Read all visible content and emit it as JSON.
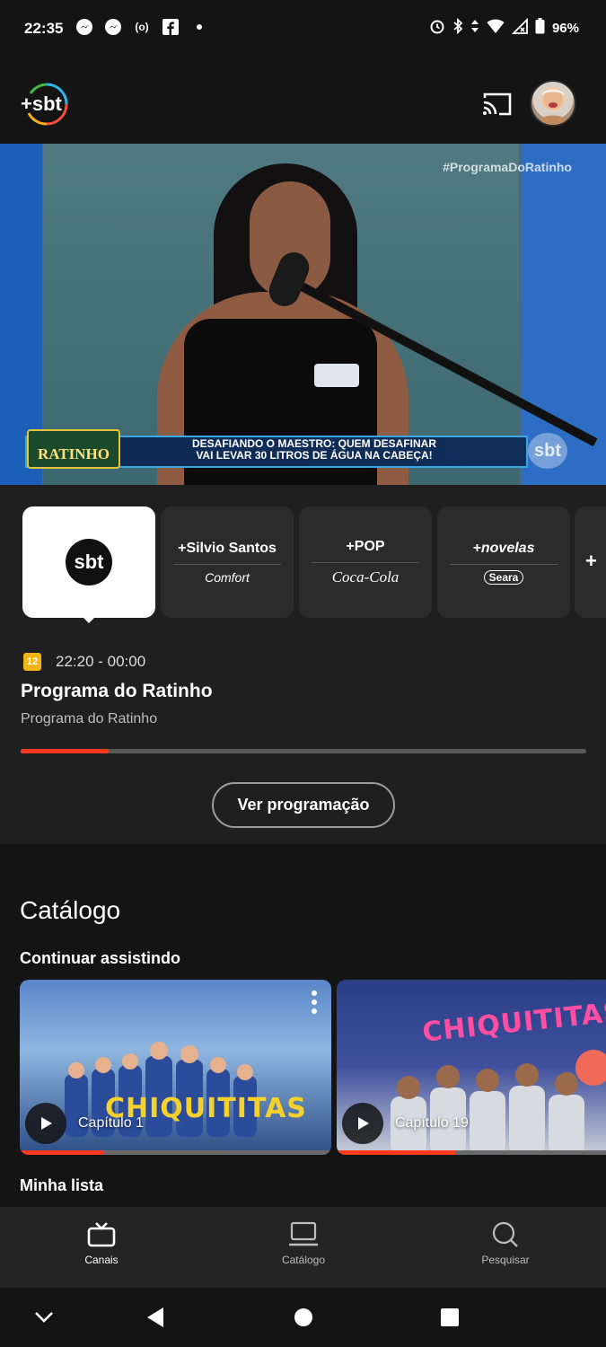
{
  "status_bar": {
    "time": "22:35",
    "battery": "96%",
    "left_icons": [
      "messenger-icon",
      "messenger-icon",
      "radio-icon",
      "facebook-icon",
      "dot-icon"
    ],
    "right_icons": [
      "alarm-icon",
      "bluetooth-icon",
      "data-icon",
      "wifi-icon",
      "signal-icon",
      "battery-icon"
    ]
  },
  "header": {
    "logo_text": "+sbt",
    "cast_icon": "cast-icon",
    "avatar_icon": "avatar"
  },
  "video": {
    "hashtag": "#ProgramaDoRatinho",
    "show_logo": "RATINHO",
    "caption_line1": "DESAFIANDO O MAESTRO: QUEM DESAFINAR",
    "caption_line2": "VAI LEVAR 30 LITROS DE ÁGUA NA CABEÇA!",
    "channel_bug": "sbt"
  },
  "channels": [
    {
      "name": "sbt",
      "sponsor": "",
      "active": true
    },
    {
      "name": "+Silvio Santos",
      "sponsor": "Comfort"
    },
    {
      "name": "+POP",
      "sponsor": "Coca-Cola"
    },
    {
      "name": "+novelas",
      "sponsor": "Seara"
    },
    {
      "name": "+"
    }
  ],
  "now_playing": {
    "rating": "12",
    "time_range": "22:20 - 00:00",
    "title": "Programa do Ratinho",
    "subtitle": "Programa do Ratinho",
    "progress": 0.155,
    "schedule_button": "Ver programação"
  },
  "catalog": {
    "title": "Catálogo",
    "continue_title": "Continuar assistindo",
    "episodes": [
      {
        "label": "Capítulo 1",
        "show": "CHIQUITITAS",
        "progress": 0.27
      },
      {
        "label": "Capítulo 19",
        "show": "CHIQUITITAS",
        "progress": 0.44
      }
    ],
    "my_list_title": "Minha lista"
  },
  "bottom_nav": [
    {
      "label": "Canais",
      "icon": "tv-icon",
      "active": true
    },
    {
      "label": "Catálogo",
      "icon": "laptop-icon",
      "active": false
    },
    {
      "label": "Pesquisar",
      "icon": "search-icon",
      "active": false
    }
  ],
  "colors": {
    "accent": "#ff3a1f",
    "background": "#141414",
    "panel": "#1f1f1f",
    "rating": "#f2b516"
  }
}
